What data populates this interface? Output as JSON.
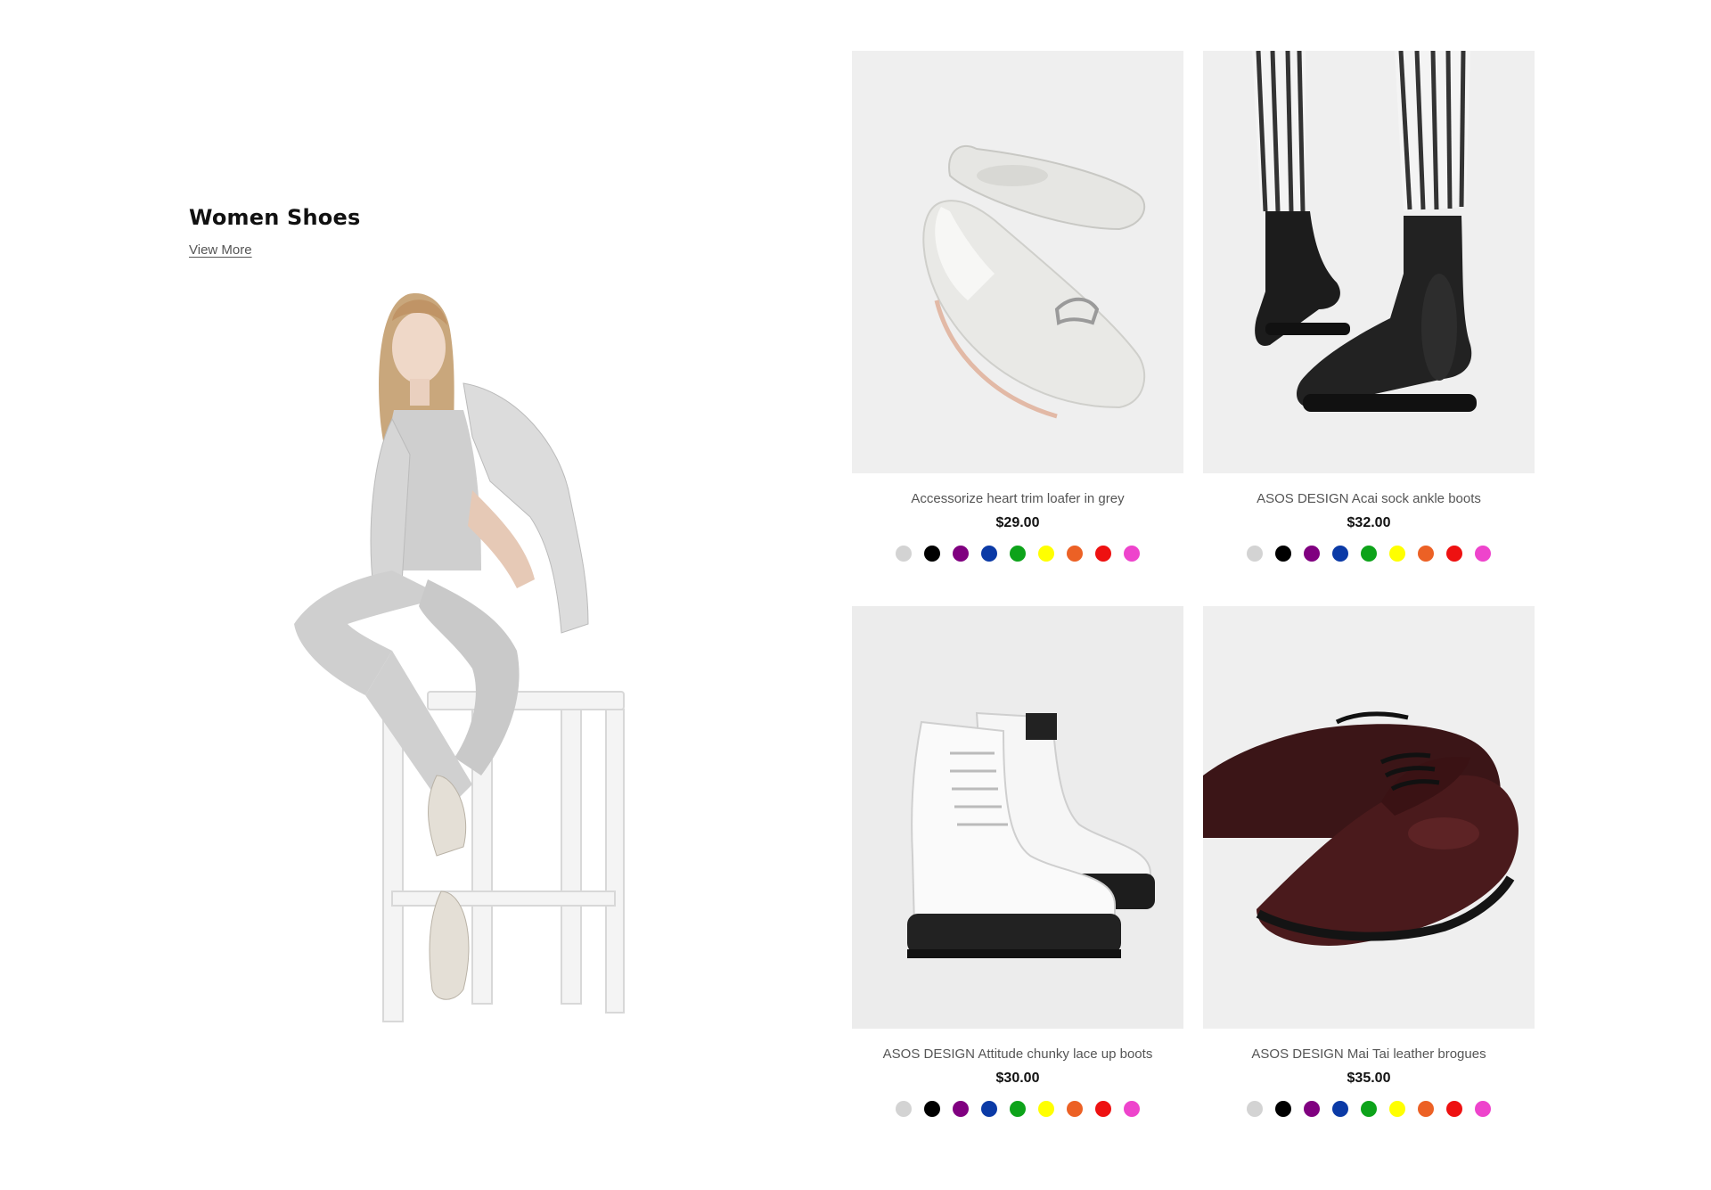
{
  "hero": {
    "title": "Women Shoes",
    "link_label": "View More"
  },
  "swatch_colors": [
    "#d3d3d3",
    "#000000",
    "#800080",
    "#0b3aa6",
    "#0da31a",
    "#ffff00",
    "#ec6125",
    "#ee1111",
    "#ee44cc"
  ],
  "products": [
    {
      "name": "Accessorize heart trim loafer in grey",
      "price": "$29.00"
    },
    {
      "name": "ASOS DESIGN Acai sock ankle boots",
      "price": "$32.00"
    },
    {
      "name": "ASOS DESIGN Attitude chunky lace up boots",
      "price": "$30.00"
    },
    {
      "name": "ASOS DESIGN Mai Tai leather brogues",
      "price": "$35.00"
    }
  ]
}
